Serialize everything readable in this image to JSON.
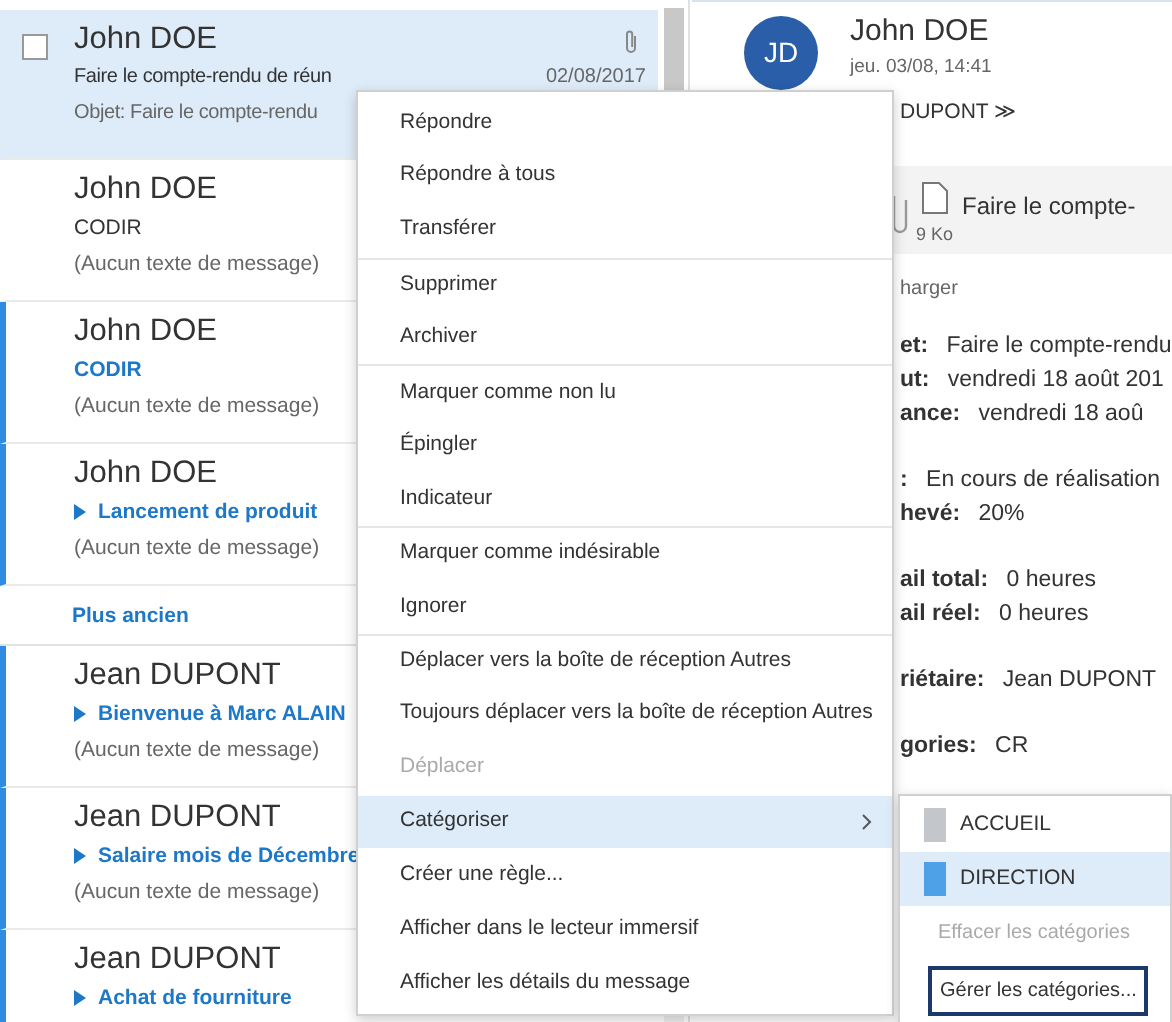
{
  "message_list": [
    {
      "kind": "message",
      "sender": "John DOE",
      "subject": "Faire le compte-rendu de réun",
      "preview": "Objet: Faire le compte-rendu",
      "date": "02/08/2017",
      "selected": true,
      "unread": false,
      "has_attachment": true,
      "expandable": false
    },
    {
      "kind": "message",
      "sender": "John DOE",
      "subject": "CODIR",
      "preview": "(Aucun texte de message)",
      "selected": false,
      "unread": false,
      "expandable": false
    },
    {
      "kind": "message",
      "sender": "John DOE",
      "subject": "CODIR",
      "preview": "(Aucun texte de message)",
      "selected": false,
      "unread": true,
      "expandable": false
    },
    {
      "kind": "message",
      "sender": "John DOE",
      "subject": "Lancement de produit",
      "preview": "(Aucun texte de message)",
      "selected": false,
      "unread": true,
      "expandable": true
    },
    {
      "kind": "header",
      "label": "Plus ancien"
    },
    {
      "kind": "message",
      "sender": "Jean DUPONT",
      "subject": "Bienvenue à Marc ALAIN",
      "preview": "(Aucun texte de message)",
      "selected": false,
      "unread": true,
      "expandable": true
    },
    {
      "kind": "message",
      "sender": "Jean DUPONT",
      "subject": "Salaire mois de Décembre",
      "preview": "(Aucun texte de message)",
      "selected": false,
      "unread": true,
      "expandable": true
    },
    {
      "kind": "message",
      "sender": "Jean DUPONT",
      "subject": "Achat de fourniture",
      "selected": false,
      "unread": true,
      "expandable": true
    }
  ],
  "reading_pane": {
    "avatar": "JD",
    "sender": "John DOE",
    "datetime": "jeu. 03/08, 14:41",
    "recipient": "DUPONT ≫",
    "attachment": {
      "name": "Faire le compte-",
      "size": "9 Ko"
    },
    "download": "harger",
    "detail_groups": [
      [
        {
          "label": "et:",
          "value": "Faire le compte-rendu"
        },
        {
          "label": "ut:",
          "value": "vendredi 18 août 201"
        },
        {
          "label": "ance:",
          "value": "vendredi 18 aoû"
        }
      ],
      [
        {
          "label": ":",
          "value": "En cours de réalisation"
        },
        {
          "label": "hevé:",
          "value": "20%"
        }
      ],
      [
        {
          "label": "ail total:",
          "value": "0 heures"
        },
        {
          "label": "ail réel:",
          "value": "0 heures"
        }
      ],
      [
        {
          "label": "riétaire:",
          "value": "Jean DUPONT"
        }
      ],
      [
        {
          "label": "gories:",
          "value": "CR"
        }
      ]
    ]
  },
  "context_menu": [
    [
      {
        "label": "Répondre",
        "kind": "command",
        "disabled": false,
        "selected": false
      },
      {
        "label": "Répondre à tous",
        "kind": "command",
        "disabled": false,
        "selected": false
      },
      {
        "label": "Transférer",
        "kind": "command",
        "disabled": false,
        "selected": false
      }
    ],
    [
      {
        "label": "Supprimer",
        "kind": "command",
        "disabled": false,
        "selected": false
      },
      {
        "label": "Archiver",
        "kind": "command",
        "disabled": false,
        "selected": false
      }
    ],
    [
      {
        "label": "Marquer comme non lu",
        "kind": "command",
        "disabled": false,
        "selected": false
      },
      {
        "label": "Épingler",
        "kind": "command",
        "disabled": false,
        "selected": false
      },
      {
        "label": "Indicateur",
        "kind": "command",
        "disabled": false,
        "selected": false
      }
    ],
    [
      {
        "label": "Marquer comme indésirable",
        "kind": "command",
        "disabled": false,
        "selected": false
      },
      {
        "label": "Ignorer",
        "kind": "command",
        "disabled": false,
        "selected": false
      }
    ],
    [
      {
        "label": "Déplacer vers la boîte de réception Autres",
        "kind": "command",
        "disabled": false,
        "selected": false
      },
      {
        "label": "Toujours déplacer vers la boîte de réception Autres",
        "kind": "command",
        "disabled": false,
        "selected": false
      },
      {
        "label": "Déplacer",
        "kind": "command",
        "disabled": true,
        "selected": false
      },
      {
        "label": "Catégoriser",
        "kind": "submenu",
        "disabled": false,
        "selected": true
      },
      {
        "label": "Créer une règle...",
        "kind": "command",
        "disabled": false,
        "selected": false
      },
      {
        "label": "Afficher dans le lecteur immersif",
        "kind": "command",
        "disabled": false,
        "selected": false
      },
      {
        "label": "Afficher les détails du message",
        "kind": "command",
        "disabled": false,
        "selected": false
      }
    ]
  ],
  "category_submenu": {
    "categories": [
      {
        "label": "ACCUEIL",
        "color": "#c3c7cc",
        "selected": false
      },
      {
        "label": "DIRECTION",
        "color": "#4ea1e6",
        "selected": true
      }
    ],
    "clear": {
      "label": "Effacer les catégories",
      "disabled": true
    },
    "manage": {
      "label": "Gérer les catégories...",
      "focused": true
    }
  }
}
